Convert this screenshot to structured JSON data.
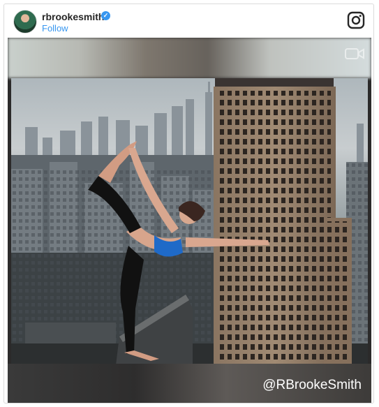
{
  "post": {
    "username": "rbrookesmith",
    "follow_label": "Follow",
    "watermark": "@RBrookeSmith",
    "verified_icon": "verified-badge-icon",
    "logo_icon": "instagram-logo-icon",
    "media_icon": "video-camera-icon"
  },
  "colors": {
    "accent": "#3897f0",
    "text": "#262626",
    "border": "#dbdbdb"
  }
}
